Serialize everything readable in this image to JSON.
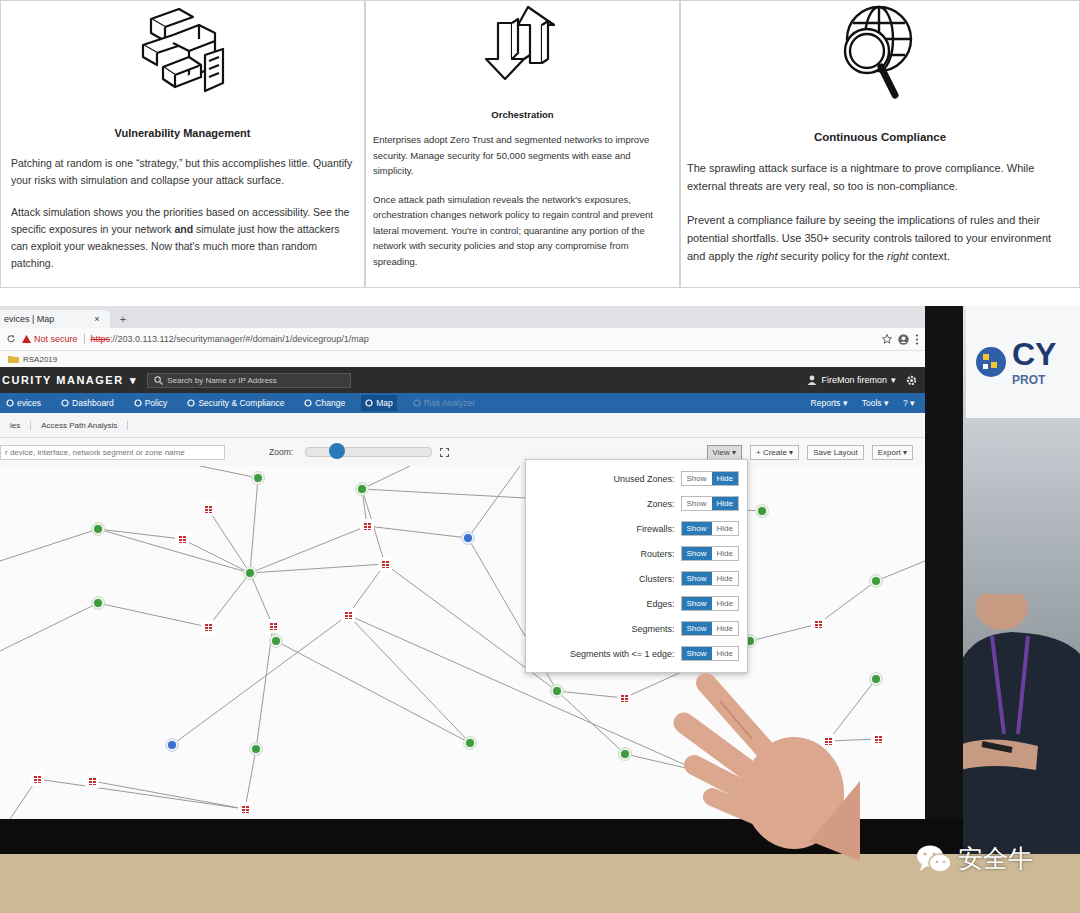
{
  "cards": [
    {
      "title": "Vulnerability Management",
      "icon": "blocks",
      "paragraphs": [
        [
          {
            "text": "Patching at random is one “strategy,” but this accomplishes little. Quantify your risks with simulation and collapse your attack surface.",
            "emphasis": "normal"
          }
        ],
        [
          {
            "text": "Attack simulation shows you the priorities based on accessibility. See the specific exposures in your network ",
            "emphasis": "normal"
          },
          {
            "text": "and",
            "emphasis": "bold"
          },
          {
            "text": " simulate just how the attackers can exploit your weaknesses. Now that's much more than random patching.",
            "emphasis": "normal"
          }
        ]
      ]
    },
    {
      "title": "Orchestration",
      "icon": "arrows",
      "paragraphs": [
        [
          {
            "text": "Enterprises adopt Zero Trust and segmented networks to improve security. Manage security for 50,000 segments with ease and simplicity.",
            "emphasis": "normal"
          }
        ],
        [
          {
            "text": "Once attack path simulation reveals the network's exposures, orchestration changes network policy to regain control and prevent lateral movement. You're in control; quarantine any portion of the network with security policies and stop any compromise from spreading.",
            "emphasis": "normal"
          }
        ]
      ]
    },
    {
      "title": "Continuous Compliance",
      "icon": "globe",
      "paragraphs": [
        [
          {
            "text": "The sprawling attack surface is a nightmare to prove compliance. While external threats are very real, so too is non-compliance.",
            "emphasis": "normal"
          }
        ],
        [
          {
            "text": "Prevent a compliance failure by seeing the implications of rules and their potential shortfalls. Use 350+ security controls tailored to your environment and apply the ",
            "emphasis": "normal"
          },
          {
            "text": "right",
            "emphasis": "italic"
          },
          {
            "text": " security policy for the ",
            "emphasis": "normal"
          },
          {
            "text": "right",
            "emphasis": "italic"
          },
          {
            "text": " context.",
            "emphasis": "normal"
          }
        ]
      ]
    }
  ],
  "photo": {
    "browser": {
      "tab": "evices | Map",
      "tab_close": "×",
      "new_tab": "+",
      "security": "Not secure",
      "url_scheme": "https",
      "url_rest": "://203.0.113.112/securitymanager/#/domain/1/devicegroup/1/map",
      "bookmark": "RSA2019"
    },
    "app": {
      "brand": "CURITY MANAGER",
      "brand_caret": "▾",
      "search_placeholder": "Search by Name or IP Address",
      "user": "FireMon firemon",
      "user_caret": "▾"
    },
    "nav": [
      {
        "label": "evices",
        "selected": false,
        "disabled": false
      },
      {
        "label": "Dashboard",
        "selected": false,
        "disabled": false
      },
      {
        "label": "Policy",
        "selected": false,
        "disabled": false
      },
      {
        "label": "Security & Compliance",
        "selected": false,
        "disabled": false
      },
      {
        "label": "Change",
        "selected": false,
        "disabled": false
      },
      {
        "label": "Map",
        "selected": true,
        "disabled": false
      },
      {
        "label": "Risk Analyzer",
        "selected": false,
        "disabled": true
      }
    ],
    "nav_right": [
      "Reports ▾",
      "Tools ▾",
      "? ▾"
    ],
    "breadcrumb": [
      "ies",
      "Access Path Analysis"
    ],
    "toolbar": {
      "search_placeholder": "r device, interface, network segment or zone name",
      "zoom_label": "Zoom:",
      "zoom_level": 0.25,
      "buttons": [
        {
          "label": "View ▾",
          "selected": true
        },
        {
          "label": "+ Create ▾",
          "selected": false
        },
        {
          "label": "Save Layout",
          "selected": false
        },
        {
          "label": "Export ▾",
          "selected": false
        }
      ]
    },
    "toggle_labels": [
      "Show",
      "Hide"
    ],
    "view_menu": [
      {
        "label": "Unused Zones:",
        "show": false
      },
      {
        "label": "Zones:",
        "show": false
      },
      {
        "label": "Firewalls:",
        "show": true
      },
      {
        "label": "Routers:",
        "show": true
      },
      {
        "label": "Clusters:",
        "show": true
      },
      {
        "label": "Edges:",
        "show": true
      },
      {
        "label": "Segments:",
        "show": true
      },
      {
        "label": "Segments with <= 1 edge:",
        "show": true
      }
    ],
    "map_nodes": [
      {
        "kind": "router"
      },
      {
        "kind": "router"
      },
      {
        "kind": "firewall"
      },
      {
        "kind": "firewall"
      },
      {
        "kind": "router"
      },
      {
        "kind": "firewall"
      },
      {
        "kind": "cluster"
      },
      {
        "kind": "firewall"
      },
      {
        "kind": "router"
      },
      {
        "kind": "router"
      },
      {
        "kind": "firewall"
      },
      {
        "kind": "firewall"
      },
      {
        "kind": "firewall"
      },
      {
        "kind": "router"
      },
      {
        "kind": "router"
      },
      {
        "kind": "router"
      },
      {
        "kind": "firewall"
      },
      {
        "kind": "router"
      },
      {
        "kind": "cluster"
      },
      {
        "kind": "router"
      },
      {
        "kind": "router"
      },
      {
        "kind": "firewall"
      },
      {
        "kind": "router"
      },
      {
        "kind": "firewall"
      },
      {
        "kind": "router"
      },
      {
        "kind": "router"
      },
      {
        "kind": "firewall"
      },
      {
        "kind": "firewall"
      },
      {
        "kind": "firewall"
      },
      {
        "kind": "firewall"
      },
      {
        "kind": "firewall"
      },
      {
        "kind": "cluster"
      }
    ],
    "booth_sign": [
      "CY",
      "PROT"
    ]
  },
  "watermark": "安全牛"
}
